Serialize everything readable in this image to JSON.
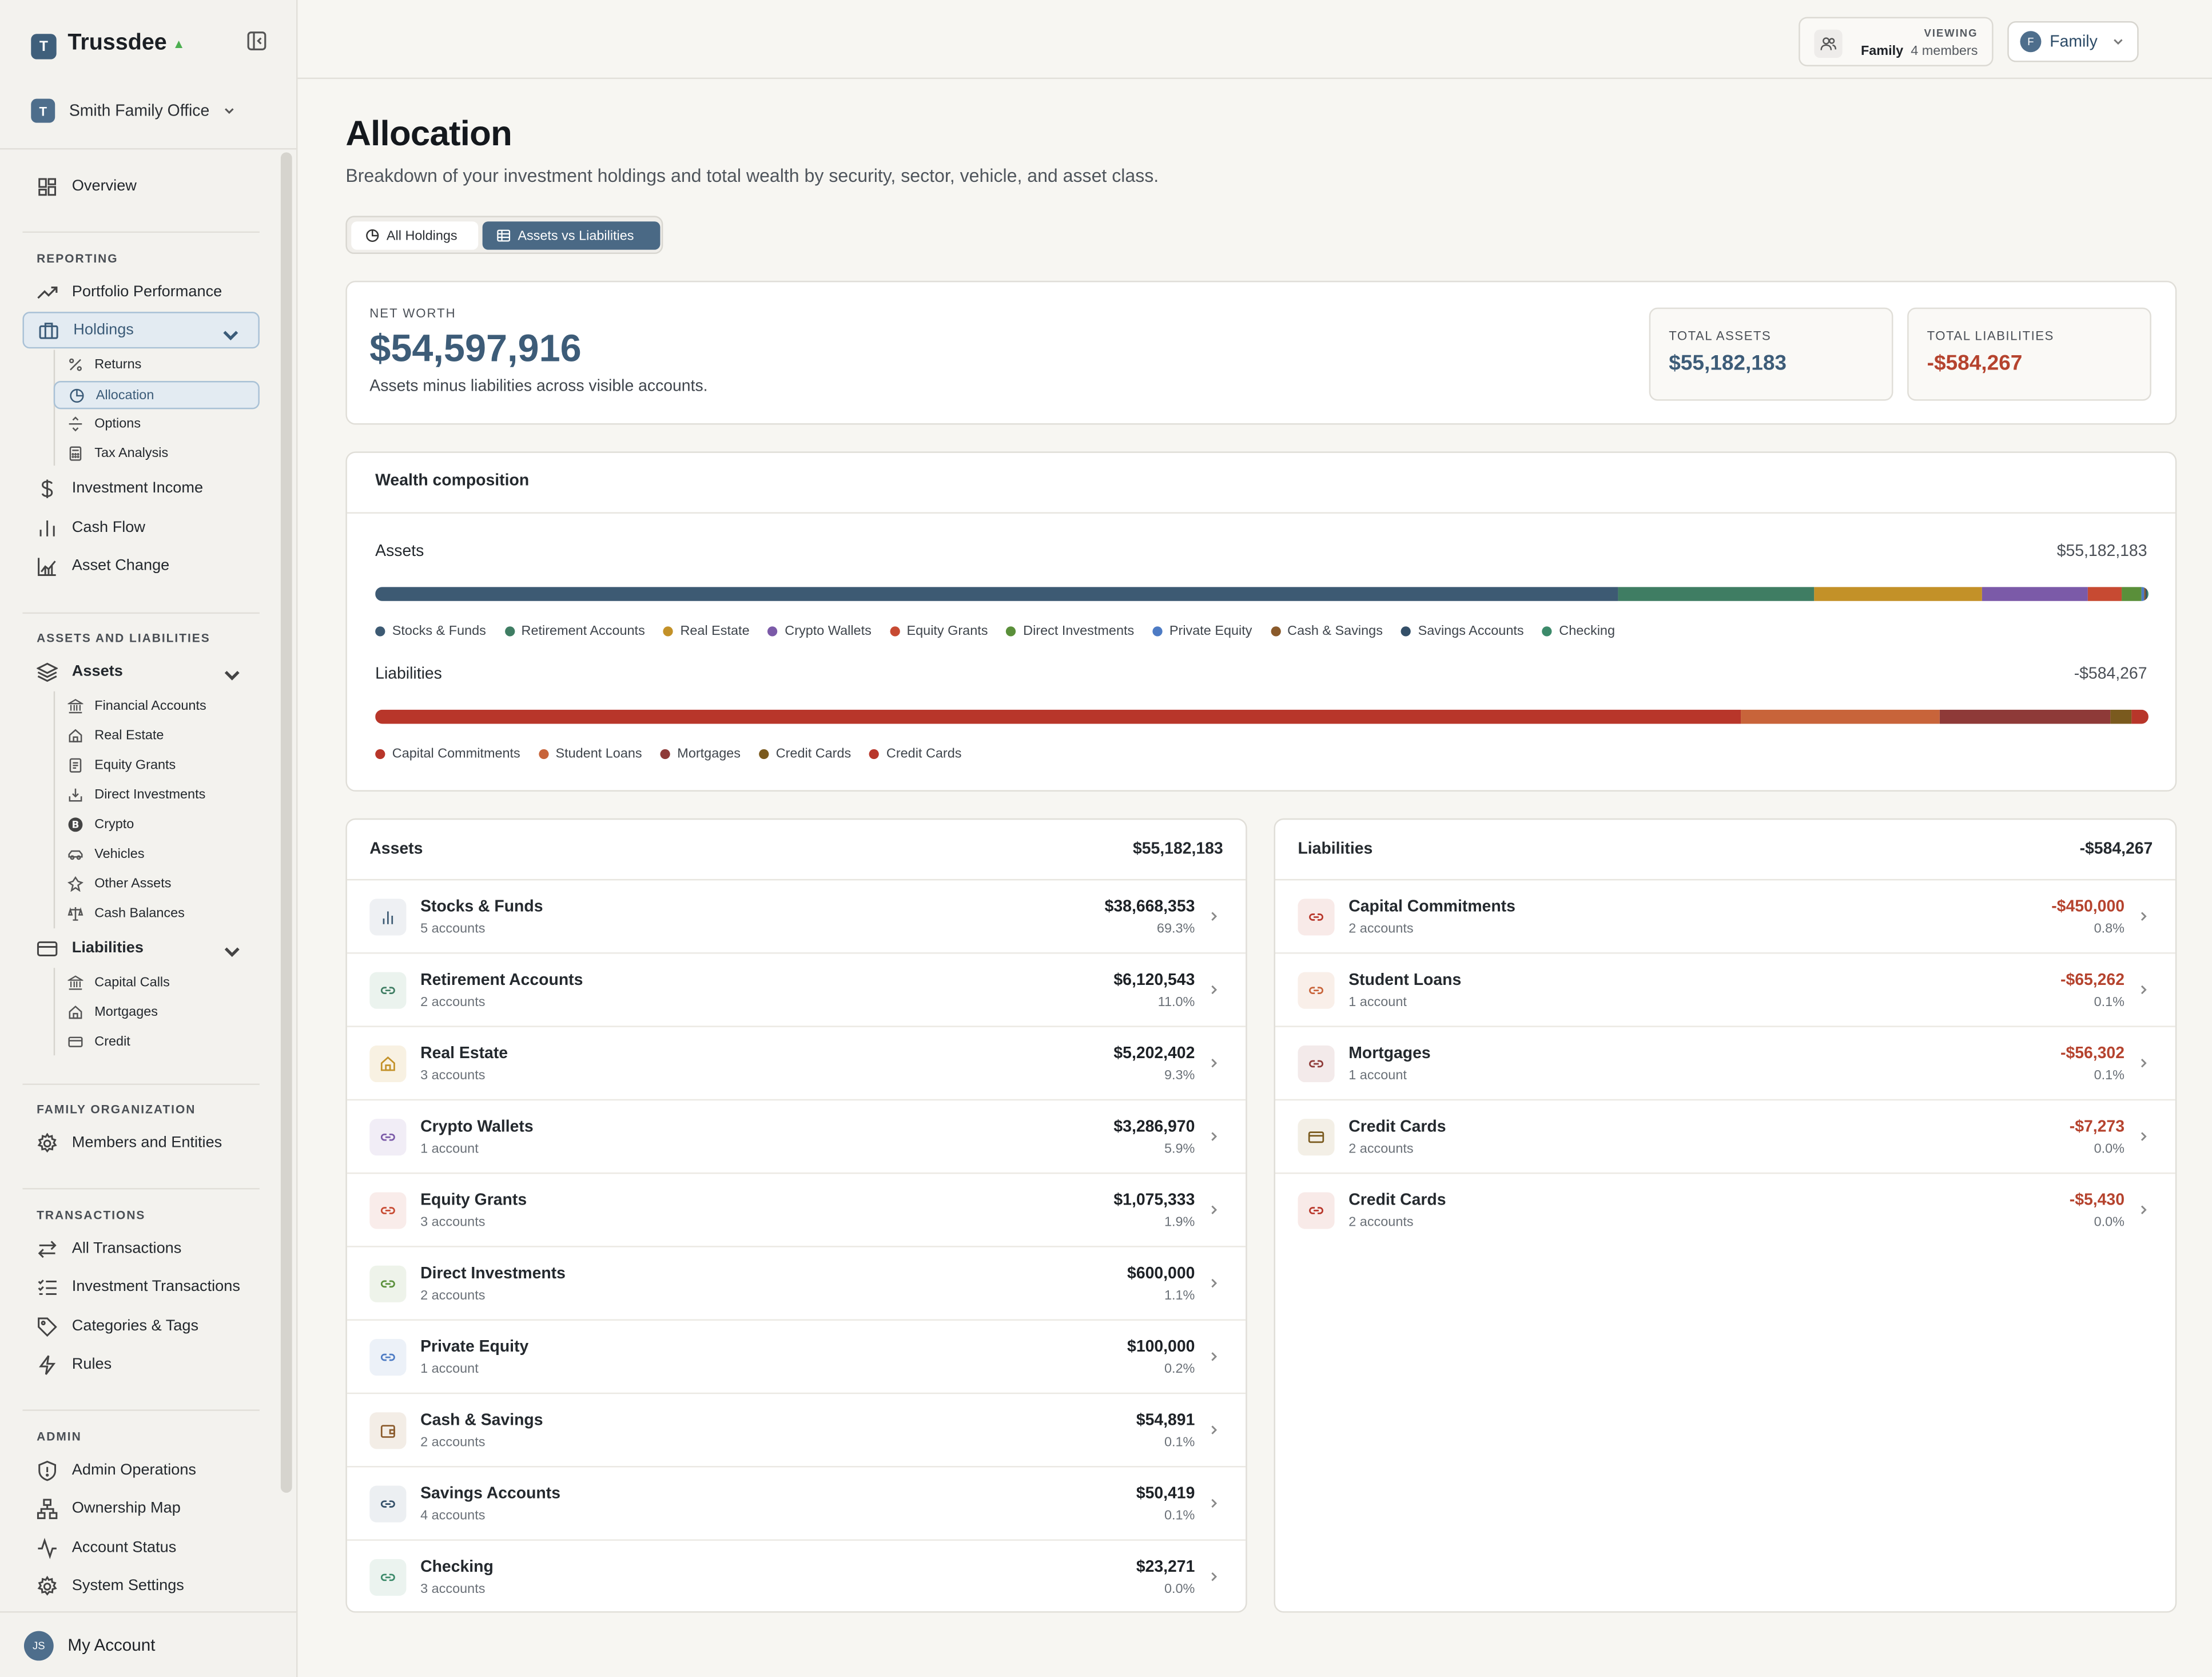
{
  "app": {
    "name": "Trussdee",
    "logo_letter": "T"
  },
  "org": {
    "name": "Smith Family Office",
    "logo_letter": "T"
  },
  "nav": {
    "overview": "Overview",
    "section_reporting": "REPORTING",
    "portfolio_performance": "Portfolio Performance",
    "holdings": "Holdings",
    "returns": "Returns",
    "allocation": "Allocation",
    "options": "Options",
    "tax_analysis": "Tax Analysis",
    "investment_income": "Investment Income",
    "cash_flow": "Cash Flow",
    "asset_change": "Asset Change",
    "section_assets_liabilities": "ASSETS AND LIABILITIES",
    "assets": "Assets",
    "financial_accounts": "Financial Accounts",
    "real_estate": "Real Estate",
    "equity_grants": "Equity Grants",
    "direct_investments": "Direct Investments",
    "crypto": "Crypto",
    "vehicles": "Vehicles",
    "other_assets": "Other Assets",
    "cash_balances": "Cash Balances",
    "liabilities": "Liabilities",
    "capital_calls": "Capital Calls",
    "mortgages": "Mortgages",
    "credit": "Credit",
    "section_family": "FAMILY ORGANIZATION",
    "members_entities": "Members and Entities",
    "section_transactions": "TRANSACTIONS",
    "all_transactions": "All Transactions",
    "investment_transactions": "Investment Transactions",
    "categories_tags": "Categories & Tags",
    "rules": "Rules",
    "section_admin": "ADMIN",
    "admin_operations": "Admin Operations",
    "ownership_map": "Ownership Map",
    "account_status": "Account Status",
    "system_settings": "System Settings"
  },
  "account": {
    "label": "My Account",
    "initials": "JS"
  },
  "topbar": {
    "viewing_label": "VIEWING",
    "viewing_name": "Family",
    "viewing_members": "4 members",
    "family_button": "Family",
    "family_initial": "F"
  },
  "page": {
    "title": "Allocation",
    "subtitle": "Breakdown of your investment holdings and total wealth by security, sector, vehicle, and asset class.",
    "tabs": [
      "All Holdings",
      "Assets vs Liabilities"
    ],
    "active_tab": "Assets vs Liabilities"
  },
  "net_worth": {
    "label": "NET WORTH",
    "value": "$54,597,916",
    "description": "Assets minus liabilities across visible accounts.",
    "total_assets_label": "TOTAL ASSETS",
    "total_assets": "$55,182,183",
    "total_liabilities_label": "TOTAL LIABILITIES",
    "total_liabilities": "-$584,267"
  },
  "composition": {
    "title": "Wealth composition",
    "assets_label": "Assets",
    "assets_total": "$55,182,183",
    "liabilities_label": "Liabilities",
    "liabilities_total": "-$584,267",
    "asset_segments": [
      {
        "name": "Stocks & Funds",
        "value": 38668353,
        "color": "#3d5a73"
      },
      {
        "name": "Retirement Accounts",
        "value": 6120543,
        "color": "#3f7d63"
      },
      {
        "name": "Real Estate",
        "value": 5202402,
        "color": "#c39128"
      },
      {
        "name": "Crypto Wallets",
        "value": 3286970,
        "color": "#7b5aa8"
      },
      {
        "name": "Equity Grants",
        "value": 1075333,
        "color": "#c74a32"
      },
      {
        "name": "Direct Investments",
        "value": 600000,
        "color": "#5a8f3a"
      },
      {
        "name": "Private Equity",
        "value": 100000,
        "color": "#4d7bc4"
      },
      {
        "name": "Cash & Savings",
        "value": 54891,
        "color": "#8a5a2b"
      },
      {
        "name": "Savings Accounts",
        "value": 50419,
        "color": "#334f68"
      },
      {
        "name": "Checking",
        "value": 23271,
        "color": "#3c8a6a"
      }
    ],
    "liability_segments": [
      {
        "name": "Capital Commitments",
        "value": 450000,
        "color": "#b8362a"
      },
      {
        "name": "Student Loans",
        "value": 65262,
        "color": "#c8643a"
      },
      {
        "name": "Mortgages",
        "value": 56302,
        "color": "#8e3a38"
      },
      {
        "name": "Credit Cards",
        "value": 7273,
        "color": "#7a5a1e"
      },
      {
        "name": "Credit Cards",
        "value": 5430,
        "color": "#b8362a"
      }
    ]
  },
  "assets_table": {
    "title": "Assets",
    "total": "$55,182,183",
    "rows": [
      {
        "name": "Stocks & Funds",
        "sub": "5 accounts",
        "value": "$38,668,353",
        "pct": "69.3%",
        "icon": "bar-chart-icon",
        "bg": "#eef0f3",
        "fg": "#3d5a73"
      },
      {
        "name": "Retirement Accounts",
        "sub": "2 accounts",
        "value": "$6,120,543",
        "pct": "11.0%",
        "icon": "link-icon",
        "bg": "#ebf3ee",
        "fg": "#3f7d63"
      },
      {
        "name": "Real Estate",
        "sub": "3 accounts",
        "value": "$5,202,402",
        "pct": "9.3%",
        "icon": "house-icon",
        "bg": "#f8f1e2",
        "fg": "#c39128"
      },
      {
        "name": "Crypto Wallets",
        "sub": "1 account",
        "value": "$3,286,970",
        "pct": "5.9%",
        "icon": "link-icon",
        "bg": "#f1edf6",
        "fg": "#7b5aa8"
      },
      {
        "name": "Equity Grants",
        "sub": "3 accounts",
        "value": "$1,075,333",
        "pct": "1.9%",
        "icon": "link-icon",
        "bg": "#f9ecea",
        "fg": "#c74a32"
      },
      {
        "name": "Direct Investments",
        "sub": "2 accounts",
        "value": "$600,000",
        "pct": "1.1%",
        "icon": "link-icon",
        "bg": "#eef3ea",
        "fg": "#5a8f3a"
      },
      {
        "name": "Private Equity",
        "sub": "1 account",
        "value": "$100,000",
        "pct": "0.2%",
        "icon": "link-icon",
        "bg": "#ecf1f8",
        "fg": "#4d7bc4"
      },
      {
        "name": "Cash & Savings",
        "sub": "2 accounts",
        "value": "$54,891",
        "pct": "0.1%",
        "icon": "wallet-icon",
        "bg": "#f3ede6",
        "fg": "#8a5a2b"
      },
      {
        "name": "Savings Accounts",
        "sub": "4 accounts",
        "value": "$50,419",
        "pct": "0.1%",
        "icon": "link-icon",
        "bg": "#eceff2",
        "fg": "#334f68"
      },
      {
        "name": "Checking",
        "sub": "3 accounts",
        "value": "$23,271",
        "pct": "0.0%",
        "icon": "link-icon",
        "bg": "#ebf3ef",
        "fg": "#3c8a6a"
      }
    ]
  },
  "liabilities_table": {
    "title": "Liabilities",
    "total": "-$584,267",
    "rows": [
      {
        "name": "Capital Commitments",
        "sub": "2 accounts",
        "value": "-$450,000",
        "pct": "0.8%",
        "icon": "link-icon",
        "bg": "#f8eae8",
        "fg": "#b8362a"
      },
      {
        "name": "Student Loans",
        "sub": "1 account",
        "value": "-$65,262",
        "pct": "0.1%",
        "icon": "link-icon",
        "bg": "#f9efe9",
        "fg": "#c8643a"
      },
      {
        "name": "Mortgages",
        "sub": "1 account",
        "value": "-$56,302",
        "pct": "0.1%",
        "icon": "link-icon",
        "bg": "#f3eaea",
        "fg": "#8e3a38"
      },
      {
        "name": "Credit Cards",
        "sub": "2 accounts",
        "value": "-$7,273",
        "pct": "0.0%",
        "icon": "credit-card-icon",
        "bg": "#f3efe6",
        "fg": "#7a5a1e"
      },
      {
        "name": "Credit Cards",
        "sub": "2 accounts",
        "value": "-$5,430",
        "pct": "0.0%",
        "icon": "link-icon",
        "bg": "#f8eae8",
        "fg": "#b8362a"
      }
    ]
  }
}
